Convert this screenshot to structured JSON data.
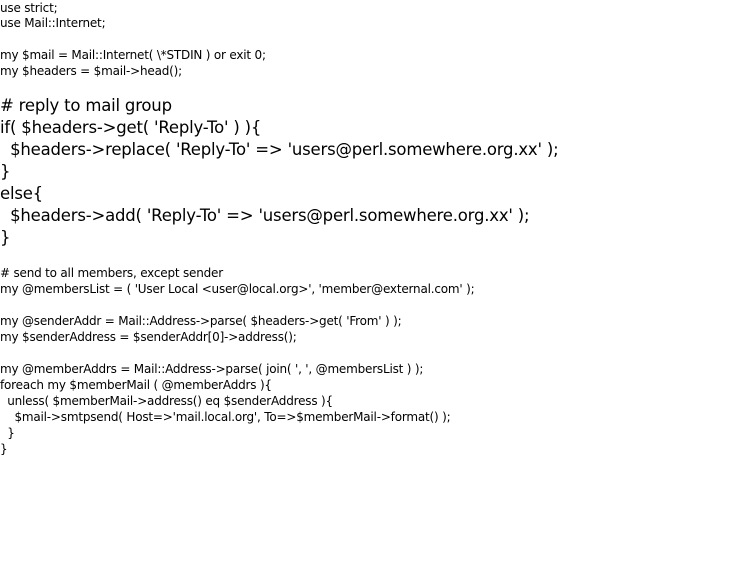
{
  "code": {
    "lines": [
      "use strict;",
      "use Mail::Internet;",
      "",
      "my $mail = Mail::Internet( \\*STDIN ) or exit 0;",
      "my $headers = $mail->head();",
      "",
      "# reply to mail group",
      "if( $headers->get( 'Reply-To' ) ){",
      "  $headers->replace( 'Reply-To' => 'users@perl.somewhere.org.xx' );",
      "}",
      "else{",
      "  $headers->add( 'Reply-To' => 'users@perl.somewhere.org.xx' );",
      "}",
      "",
      "# send to all members, except sender",
      "my @membersList = ( 'User Local <user@local.org>', 'member@external.com' );",
      "",
      "my @senderAddr = Mail::Address->parse( $headers->get( 'From' ) );",
      "my $senderAddress = $senderAddr[0]->address();",
      "",
      "my @memberAddrs = Mail::Address->parse( join( ', ', @membersList ) );",
      "foreach my $memberMail ( @memberAddrs ){",
      "  unless( $memberMail->address() eq $senderAddress ){",
      "    $mail->smtpsend( Host=>'mail.local.org', To=>$memberMail->format() );",
      "  }",
      "}"
    ]
  }
}
